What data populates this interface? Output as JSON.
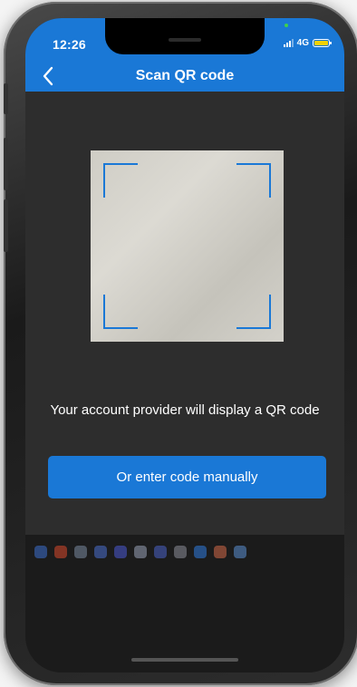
{
  "status_bar": {
    "time": "12:26",
    "network": "4G",
    "battery_color": "#f5d100"
  },
  "header": {
    "title": "Scan QR code",
    "back_icon": "chevron-left-icon",
    "background": "#1a78d6"
  },
  "scanner": {
    "corner_color": "#1a78d6"
  },
  "instructions": {
    "text": "Your account provider will display a QR code"
  },
  "actions": {
    "manual_entry_label": "Or enter code manually"
  }
}
